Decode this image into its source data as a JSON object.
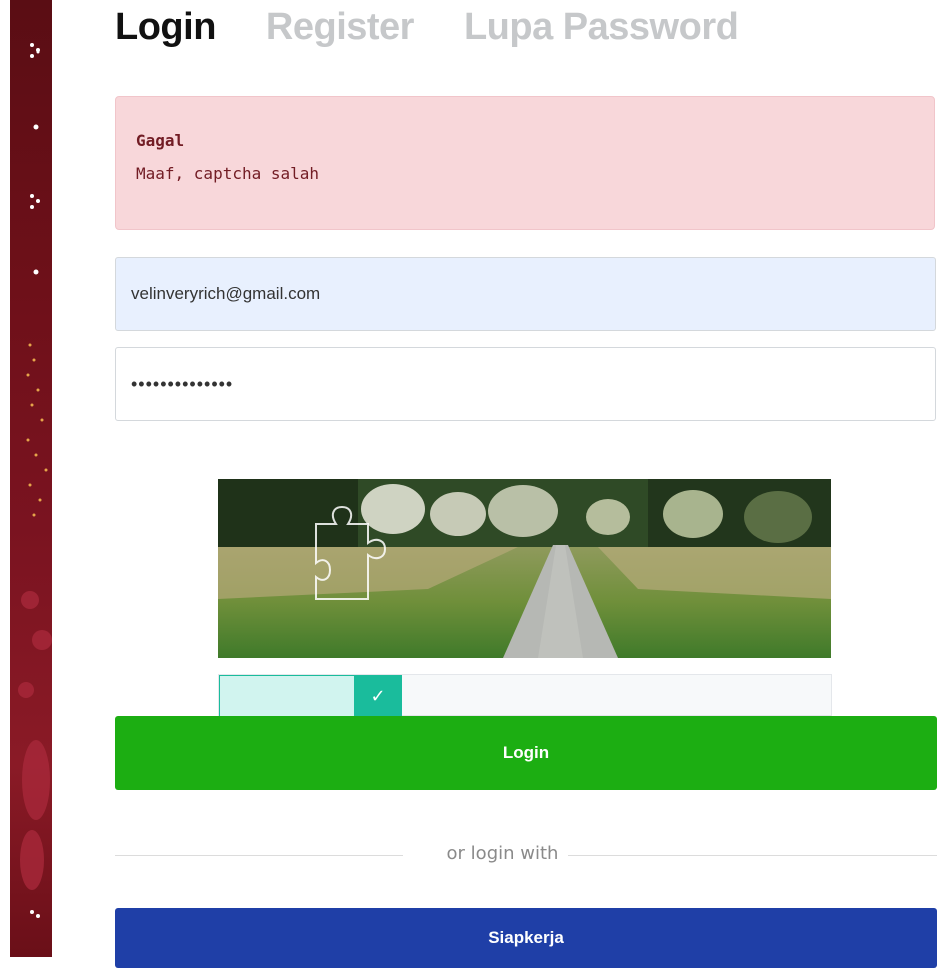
{
  "tabs": [
    {
      "label": "Login",
      "active": true
    },
    {
      "label": "Register",
      "active": false
    },
    {
      "label": "Lupa Password",
      "active": false
    }
  ],
  "alert": {
    "title": "Gagal",
    "message": "Maaf, captcha salah"
  },
  "form": {
    "email_value": "velinveryrich@gmail.com",
    "password_masked": "••••••••••••••"
  },
  "captcha": {
    "slider_progress": 0.24,
    "handle_icon": "checkmark-icon",
    "puzzle_icon": "puzzle-piece-icon"
  },
  "buttons": {
    "login_label": "Login",
    "siapkerja_label": "Siapkerja"
  },
  "divider_text": "or login with",
  "colors": {
    "alert_bg": "#f8d7da",
    "alert_text": "#721c24",
    "login_button": "#1cae12",
    "siapkerja_button": "#1f3fa7",
    "slider_accent": "#1abc9c",
    "sidebar": "#6e1019"
  }
}
